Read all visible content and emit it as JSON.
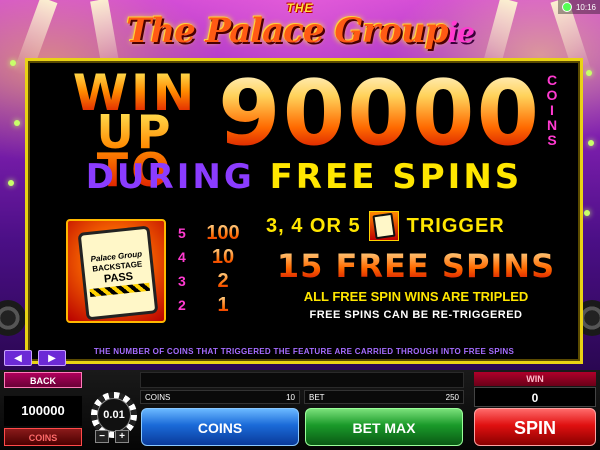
{
  "status": {
    "time": "10:16"
  },
  "logo": {
    "the": "THE",
    "main": "Palace Groupie"
  },
  "headline": {
    "win": "WIN",
    "up_to": "UP TO",
    "amount": "90000",
    "coins": [
      "C",
      "O",
      "I",
      "N",
      "S"
    ],
    "during": "DURING",
    "free_spins": "FREE SPINS"
  },
  "scatter": {
    "logo": "Palace Group",
    "backstage": "BACKSTAGE",
    "pass": "PASS"
  },
  "pay_table": [
    {
      "count": "5",
      "value": "100"
    },
    {
      "count": "4",
      "value": "10"
    },
    {
      "count": "3",
      "value": "2"
    },
    {
      "count": "2",
      "value": "1"
    }
  ],
  "feature": {
    "trigger_prefix": "3, 4 OR 5",
    "trigger_suffix": "TRIGGER",
    "free_spins": "15 FREE SPINS",
    "tripled": "ALL FREE SPIN WINS ARE TRIPLED",
    "retrigger": "FREE SPINS CAN BE RE-TRIGGERED",
    "note": "THE NUMBER OF COINS THAT TRIGGERED THE FEATURE ARE CARRIED THROUGH INTO FREE SPINS"
  },
  "nav": {
    "prev": "◀",
    "next": "▶"
  },
  "controls": {
    "back": "BACK",
    "balance": "100000",
    "coins_toggle": "COINS",
    "coin_size": "0.01",
    "minus": "−",
    "plus": "+",
    "coins_label": "COINS",
    "coins_value": "10",
    "bet_label": "BET",
    "bet_value": "250",
    "coins_button": "COINS",
    "bet_max_button": "BET MAX",
    "win_label": "WIN",
    "win_value": "0",
    "spin_button": "SPIN"
  }
}
